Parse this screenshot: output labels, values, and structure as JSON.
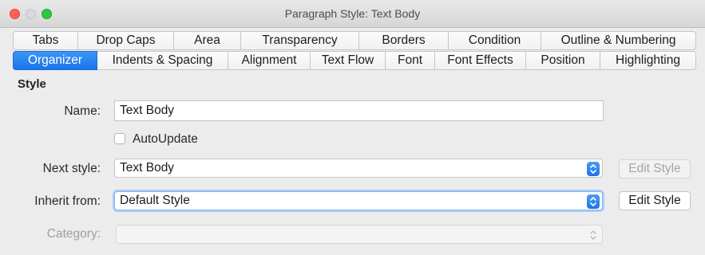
{
  "window": {
    "title": "Paragraph Style: Text Body"
  },
  "tabs_row1": [
    {
      "label": "Tabs"
    },
    {
      "label": "Drop Caps"
    },
    {
      "label": "Area"
    },
    {
      "label": "Transparency"
    },
    {
      "label": "Borders"
    },
    {
      "label": "Condition"
    },
    {
      "label": "Outline & Numbering"
    }
  ],
  "tabs_row2": [
    {
      "label": "Organizer",
      "active": true
    },
    {
      "label": "Indents & Spacing"
    },
    {
      "label": "Alignment"
    },
    {
      "label": "Text Flow"
    },
    {
      "label": "Font"
    },
    {
      "label": "Font Effects"
    },
    {
      "label": "Position"
    },
    {
      "label": "Highlighting"
    }
  ],
  "style": {
    "section_title": "Style",
    "name_label": "Name:",
    "name_value": "Text Body",
    "autoupdate_label": "AutoUpdate",
    "autoupdate_checked": false,
    "next_style_label": "Next style:",
    "next_style_value": "Text Body",
    "inherit_label": "Inherit from:",
    "inherit_value": "Default Style",
    "category_label": "Category:",
    "category_value": "",
    "edit_style_label": "Edit Style",
    "edit_style_inherit_label": "Edit Style"
  },
  "colors": {
    "accent": "#1a74e8",
    "close": "#fe5f57",
    "maximize": "#2bc840"
  },
  "icons": {
    "spin": "chevron-up-down-icon"
  }
}
